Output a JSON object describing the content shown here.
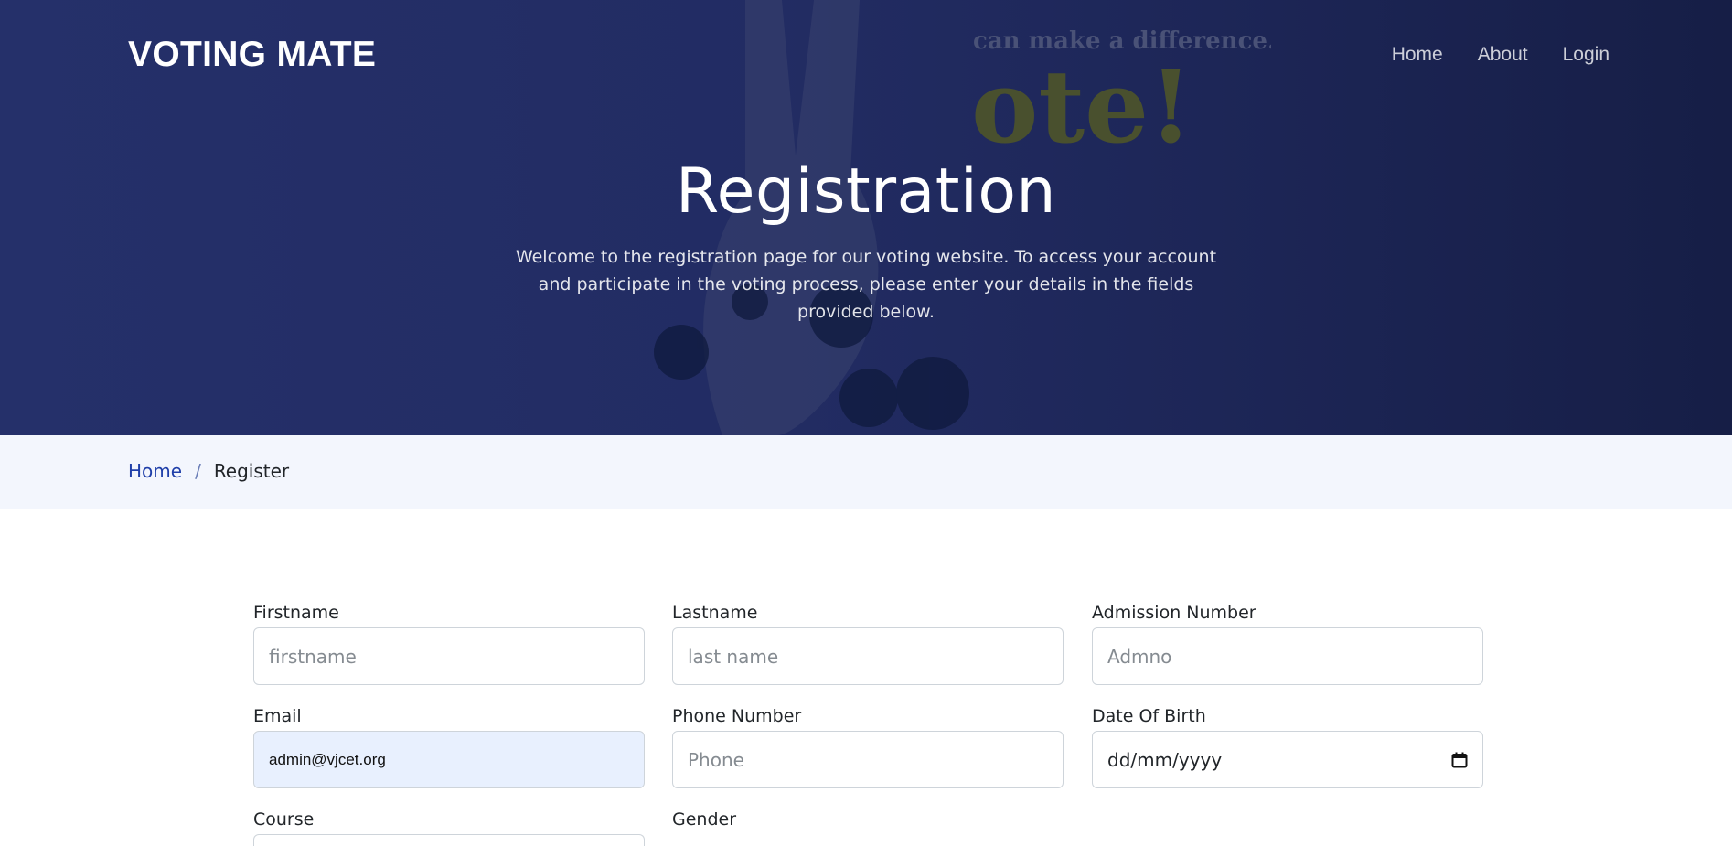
{
  "header": {
    "brand": "VOTING MATE",
    "nav": [
      "Home",
      "About",
      "Login"
    ]
  },
  "hero": {
    "title": "Registration",
    "description": "Welcome to the registration page for our voting website. To access your account and participate in the voting process, please enter your details in the fields provided below.",
    "photo_text_small": "can make a difference...",
    "photo_text_large": "ote!"
  },
  "breadcrumb": {
    "home": "Home",
    "separator": "/",
    "current": "Register"
  },
  "form": {
    "firstname": {
      "label": "Firstname",
      "placeholder": "firstname",
      "value": ""
    },
    "lastname": {
      "label": "Lastname",
      "placeholder": "last name",
      "value": ""
    },
    "admission": {
      "label": "Admission Number",
      "placeholder": "Admno",
      "value": ""
    },
    "email": {
      "label": "Email",
      "placeholder": "",
      "value": "admin@vjcet.org"
    },
    "phone": {
      "label": "Phone Number",
      "placeholder": "Phone",
      "value": ""
    },
    "dob": {
      "label": "Date Of Birth",
      "display": "dd/mm/yyyy"
    },
    "course": {
      "label": "Course"
    },
    "gender": {
      "label": "Gender"
    }
  },
  "colors": {
    "hero_bg": "#222c63",
    "breadcrumb_bg": "#f3f6fd",
    "link": "#1f3fa9",
    "autofill_bg": "#e8f0fe"
  }
}
